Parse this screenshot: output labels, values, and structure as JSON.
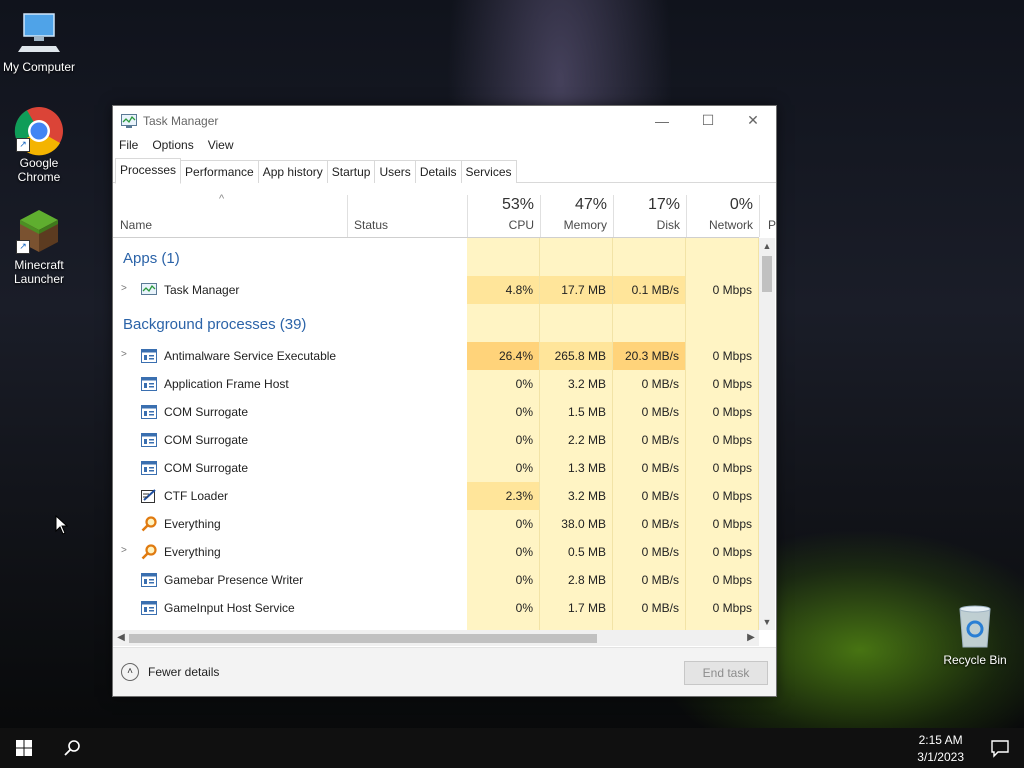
{
  "desktop": {
    "icons": [
      {
        "label": "My Computer"
      },
      {
        "label": "Google Chrome"
      },
      {
        "label": "Minecraft Launcher"
      },
      {
        "label": "Recycle Bin"
      }
    ]
  },
  "window": {
    "title": "Task Manager",
    "controls": {
      "minimize": "—",
      "maximize": "☐",
      "close": "✕"
    },
    "menu": [
      "File",
      "Options",
      "View"
    ],
    "tabs": [
      "Processes",
      "Performance",
      "App history",
      "Startup",
      "Users",
      "Details",
      "Services"
    ],
    "active_tab": "Processes",
    "header": {
      "sort_arrow": "^",
      "name": "Name",
      "status": "Status",
      "cpu_pct": "53%",
      "cpu": "CPU",
      "mem_pct": "47%",
      "mem": "Memory",
      "disk_pct": "17%",
      "disk": "Disk",
      "net_pct": "0%",
      "net": "Network",
      "more": "P"
    },
    "groups": {
      "apps": "Apps (1)",
      "background": "Background processes (39)"
    },
    "rows": [
      {
        "name": "Task Manager",
        "cpu": "4.8%",
        "mem": "17.7 MB",
        "disk": "0.1 MB/s",
        "net": "0 Mbps",
        "expand": ">"
      },
      {
        "name": "Antimalware Service Executable",
        "cpu": "26.4%",
        "mem": "265.8 MB",
        "disk": "20.3 MB/s",
        "net": "0 Mbps",
        "expand": ">"
      },
      {
        "name": "Application Frame Host",
        "cpu": "0%",
        "mem": "3.2 MB",
        "disk": "0 MB/s",
        "net": "0 Mbps"
      },
      {
        "name": "COM Surrogate",
        "cpu": "0%",
        "mem": "1.5 MB",
        "disk": "0 MB/s",
        "net": "0 Mbps"
      },
      {
        "name": "COM Surrogate",
        "cpu": "0%",
        "mem": "2.2 MB",
        "disk": "0 MB/s",
        "net": "0 Mbps"
      },
      {
        "name": "COM Surrogate",
        "cpu": "0%",
        "mem": "1.3 MB",
        "disk": "0 MB/s",
        "net": "0 Mbps"
      },
      {
        "name": "CTF Loader",
        "cpu": "2.3%",
        "mem": "3.2 MB",
        "disk": "0 MB/s",
        "net": "0 Mbps"
      },
      {
        "name": "Everything",
        "cpu": "0%",
        "mem": "38.0 MB",
        "disk": "0 MB/s",
        "net": "0 Mbps"
      },
      {
        "name": "Everything",
        "cpu": "0%",
        "mem": "0.5 MB",
        "disk": "0 MB/s",
        "net": "0 Mbps",
        "expand": ">"
      },
      {
        "name": "Gamebar Presence Writer",
        "cpu": "0%",
        "mem": "2.8 MB",
        "disk": "0 MB/s",
        "net": "0 Mbps"
      },
      {
        "name": "GameInput Host Service",
        "cpu": "0%",
        "mem": "1.7 MB",
        "disk": "0 MB/s",
        "net": "0 Mbps"
      }
    ],
    "footer": {
      "fewer_details": "Fewer details",
      "end_task": "End task"
    }
  },
  "taskbar": {
    "time": "2:15 AM",
    "date": "3/1/2023"
  },
  "colors": {
    "accent": "#2b63a8",
    "heat_low": "#fff4c4",
    "heat_mid": "#ffe59a",
    "heat_high": "#ffd37a"
  }
}
